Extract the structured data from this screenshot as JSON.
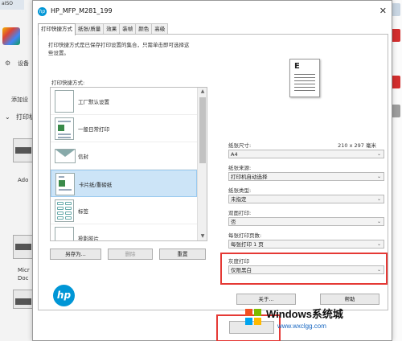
{
  "background": {
    "top_left_text": "aISO",
    "settings_label": "设备",
    "add_label": "添加设",
    "printer_section": "打印机",
    "devices": [
      "Ado",
      "Micr",
      "Doc"
    ]
  },
  "dialog": {
    "title": "HP_MFP_M281_199",
    "close_glyph": "✕",
    "tabs": [
      "打印快捷方式",
      "纸张/质量",
      "效果",
      "装帧",
      "颜色",
      "高级"
    ],
    "active_tab": 0,
    "description_lines": [
      "打印快捷方式是已保存打印设置的集合，只需单击即可选择这",
      "些设置。"
    ],
    "shortcuts_label": "打印快捷方式:",
    "shortcuts": [
      {
        "label": "工厂默认设置",
        "icon": "blank-page-icon"
      },
      {
        "label": "一般日常打印",
        "icon": "everyday-print-icon"
      },
      {
        "label": "信封",
        "icon": "envelope-icon"
      },
      {
        "label": "卡片纸/重磅纸",
        "icon": "cardstock-icon"
      },
      {
        "label": "标签",
        "icon": "labels-icon"
      },
      {
        "label": "投影胶片",
        "icon": "transparency-icon"
      }
    ],
    "selected_shortcut": 3,
    "buttons": {
      "save_as": "另存为...",
      "delete": "删除",
      "reset": "重置",
      "about": "关于...",
      "help": "帮助"
    },
    "preview_letter": "E",
    "paper_size_label": "纸张尺寸:",
    "paper_size_value": "210 x 297 毫米",
    "paper_size": "A4",
    "paper_source_label": "纸张来源:",
    "paper_source": "打印机自动选择",
    "paper_type_label": "纸张类型:",
    "paper_type": "未指定",
    "duplex_label": "双面打印:",
    "duplex": "否",
    "pages_per_sheet_label": "每张打印页数:",
    "pages_per_sheet": "每张打印 1 页",
    "grayscale_label": "灰度打印",
    "grayscale": "仅限黑白",
    "highlight_color": "#e53935",
    "hp_logo_text": "hp"
  },
  "watermark": {
    "title": "Windows系统城",
    "url": "www.wxclgg.com"
  }
}
